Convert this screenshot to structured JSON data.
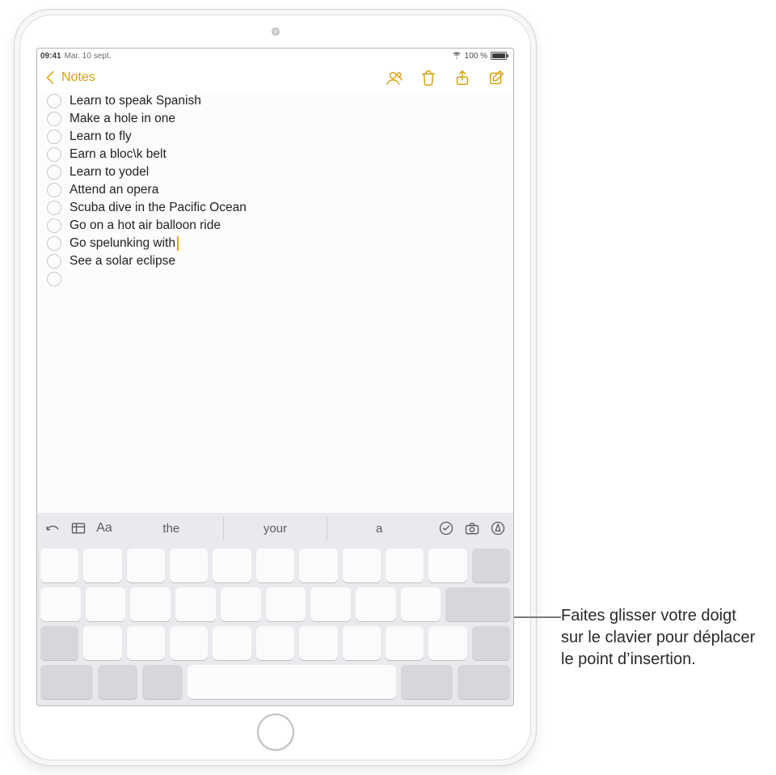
{
  "statusbar": {
    "time": "09:41",
    "date": "Mar. 10 sept.",
    "battery_text": "100 %",
    "wifi_icon": "wifi-icon"
  },
  "navbar": {
    "back_label": "Notes",
    "icons": {
      "people": "people-icon",
      "trash": "trash-icon",
      "share": "share-icon",
      "compose": "compose-icon"
    }
  },
  "note": {
    "items": [
      {
        "text": "Learn to speak Spanish",
        "has_caret": false
      },
      {
        "text": "Make a hole in one",
        "has_caret": false
      },
      {
        "text": "Learn to fly",
        "has_caret": false
      },
      {
        "text": "Earn a bloc\\k belt",
        "has_caret": false
      },
      {
        "text": "Learn to yodel",
        "has_caret": false
      },
      {
        "text": "Attend an opera",
        "has_caret": false
      },
      {
        "text": "Scuba dive in the Pacific Ocean",
        "has_caret": false
      },
      {
        "text": "Go on a hot air balloon ride",
        "has_caret": false
      },
      {
        "text": "Go spelunking with ",
        "has_caret": true
      },
      {
        "text": "See a solar eclipse",
        "has_caret": false
      },
      {
        "text": "",
        "has_caret": false
      }
    ]
  },
  "suggestbar": {
    "buttons": {
      "undo": "undo-icon",
      "table": "table-icon",
      "format": "Aa"
    },
    "suggestions": [
      "the",
      "your",
      "a"
    ],
    "right_buttons": {
      "checklist": "checklist-icon",
      "camera": "camera-icon",
      "markup": "markup-icon"
    }
  },
  "keyboard": {
    "rows": [
      {
        "keys": 11,
        "mods": [
          10
        ]
      },
      {
        "keys": 11,
        "mods": [
          10
        ]
      },
      {
        "keys": 11,
        "mods": [
          0,
          10
        ]
      },
      {
        "layout": "bottom"
      }
    ]
  },
  "callout": {
    "text": "Faites glisser votre doigt sur le clavier pour déplacer le point d’insertion."
  },
  "colors": {
    "accent": "#d9a007",
    "icon_gray": "#5a5a60",
    "keyboard_bg": "#e9eaee",
    "key_bg": "#fbfbfc",
    "key_mod_bg": "#d6d7dd"
  }
}
